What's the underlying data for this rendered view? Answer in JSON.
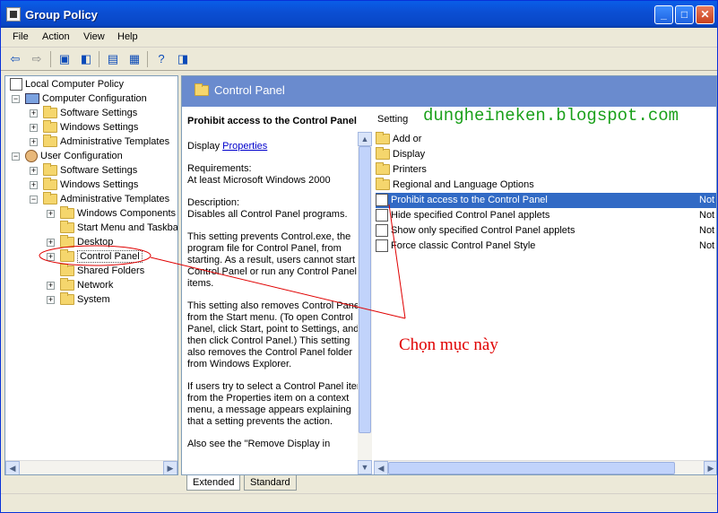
{
  "window": {
    "title": "Group Policy",
    "app_icon": "group-policy-icon"
  },
  "menu": [
    "File",
    "Action",
    "View",
    "Help"
  ],
  "toolbar": [
    "back-icon",
    "forward-icon",
    "up-folder-icon",
    "show-hide-tree-icon",
    "properties-icon",
    "export-list-icon",
    "help-icon",
    "show-hide-action-pane-icon"
  ],
  "tree": {
    "root": "Local Computer Policy",
    "computer_config": "Computer Configuration",
    "cc_software": "Software Settings",
    "cc_windows": "Windows Settings",
    "cc_admin": "Administrative Templates",
    "user_config": "User Configuration",
    "uc_software": "Software Settings",
    "uc_windows": "Windows Settings",
    "uc_admin": "Administrative Templates",
    "windows_components": "Windows Components",
    "start_menu": "Start Menu and Taskba",
    "desktop": "Desktop",
    "control_panel": "Control Panel",
    "shared_folders": "Shared Folders",
    "network": "Network",
    "system": "System"
  },
  "right_header": {
    "title": "Control Panel"
  },
  "description": {
    "title": "Prohibit access to the Control Panel",
    "display_prefix": "Display ",
    "properties_link": "Properties",
    "req_label": "Requirements:",
    "req_value": "At least Microsoft Windows 2000",
    "desc_label": "Description:",
    "desc_value": "Disables all Control Panel programs.",
    "para1": "This setting prevents Control.exe, the program file for Control Panel, from starting. As a result, users cannot start Control Panel or run any Control Panel items.",
    "para2": "This setting also removes Control Panel from the Start menu. (To open Control Panel, click Start, point to Settings, and then click Control Panel.) This setting also removes the Control Panel folder from Windows Explorer.",
    "para3": "If users try to select a Control Panel item from the Properties item on a context menu, a message appears explaining that a setting prevents the action.",
    "para4": "Also see the \"Remove Display in"
  },
  "list": {
    "col_setting": "Setting",
    "items": [
      {
        "name": "Add or",
        "state": ""
      },
      {
        "name": "Display",
        "state": ""
      },
      {
        "name": "Printers",
        "state": ""
      },
      {
        "name": "Regional and Language Options",
        "state": ""
      },
      {
        "name": "Prohibit access to the Control Panel",
        "state": "Not"
      },
      {
        "name": "Hide specified Control Panel applets",
        "state": "Not"
      },
      {
        "name": "Show only specified Control Panel applets",
        "state": "Not"
      },
      {
        "name": "Force classic Control Panel Style",
        "state": "Not"
      }
    ]
  },
  "tabs": {
    "extended": "Extended",
    "standard": "Standard"
  },
  "watermark": "dungheineken.blogspot.com",
  "annotation": "Chọn mục này",
  "colors": {
    "title_bar": "#0a5ee8",
    "header": "#6a8bce",
    "selection": "#316ac5",
    "annotation": "#e00000",
    "watermark": "#1aa01a"
  }
}
